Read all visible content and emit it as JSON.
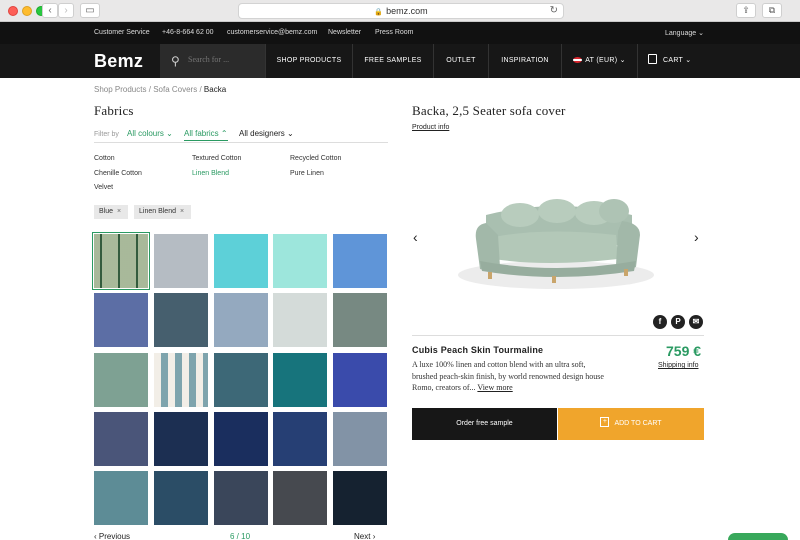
{
  "browser": {
    "url": "bemz.com"
  },
  "utility": {
    "customer_service": "Customer Service",
    "phone": "+46-8-664 62 00",
    "email": "customerservice@bemz.com",
    "newsletter": "Newsletter",
    "press": "Press Room",
    "language": "Language"
  },
  "nav": {
    "logo": "Bemz",
    "search_placeholder": "Search for ...",
    "shop": "SHOP PRODUCTS",
    "free": "FREE SAMPLES",
    "outlet": "OUTLET",
    "inspiration": "INSPIRATION",
    "currency": "AT (EUR)",
    "cart": "CART"
  },
  "breadcrumb": {
    "a": "Shop Products",
    "sep": "/",
    "b": "Sofa Covers",
    "c": "Backa"
  },
  "left": {
    "title": "Fabrics",
    "filter_by": "Filter by",
    "colours": "All colours",
    "fabrics": "All fabrics",
    "designers": "All designers",
    "types": [
      "Cotton",
      "Textured Cotton",
      "Recycled Cotton",
      "Chenille Cotton",
      "Linen Blend",
      "Pure Linen",
      "Velvet"
    ],
    "tags": [
      "Blue",
      "Linen Blend"
    ],
    "tag_x": "×",
    "swatch_colors": [
      "#cfd9c6",
      "#b5bcc3",
      "#5dd0d8",
      "#9de6dc",
      "#5f95d8",
      "#5c6ea5",
      "#465f6e",
      "#94a9bf",
      "#d4dbd9",
      "#778982",
      "#7ea193",
      "#e6e3dd",
      "#3d6877",
      "#17747c",
      "#3a4bab",
      "#4a5579",
      "#1c2f52",
      "#1a2e5e",
      "#263f74",
      "#8293a6",
      "#5d8c96",
      "#2b4d66",
      "#3a465a",
      "#46494f",
      "#152230"
    ],
    "pager": {
      "prev": "Previous",
      "page": "6 / 10",
      "next": "Next"
    }
  },
  "right": {
    "title": "Backa, 2,5 Seater sofa cover",
    "product_info": "Product info",
    "fabric_name": "Cubis Peach Skin Tourmaline",
    "description": "A luxe 100% linen and cotton blend with an ultra soft, brushed peach-skin finish, by world renowned design house Romo, creators of...",
    "view_more": "View more",
    "price": "759 €",
    "shipping": "Shipping info",
    "order_sample": "Order free sample",
    "add_to_cart": "ADD TO CART",
    "social": {
      "fb": "f",
      "pin": "P",
      "mail": "✉"
    }
  }
}
